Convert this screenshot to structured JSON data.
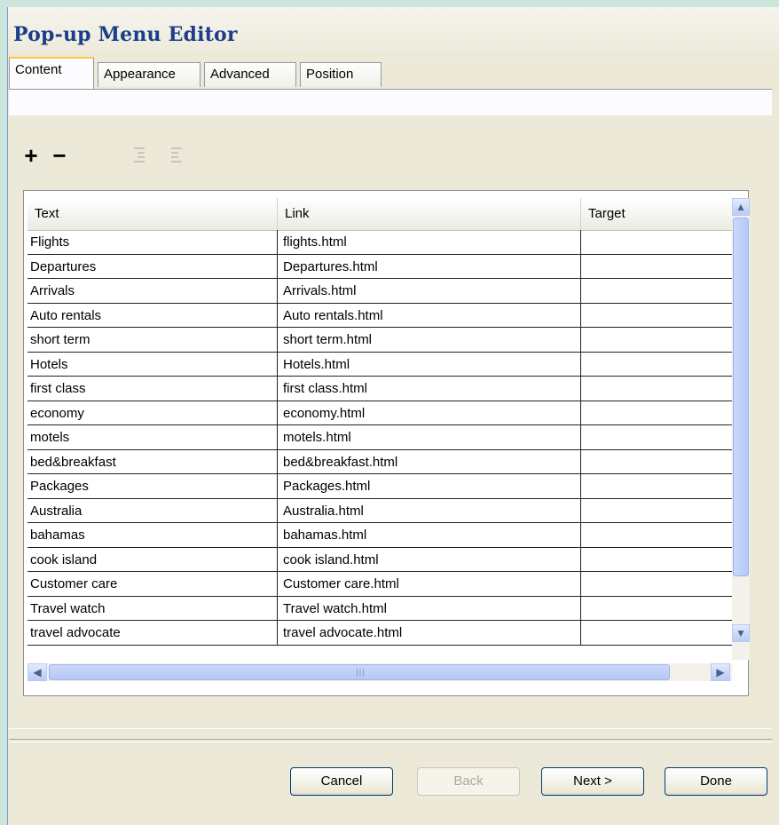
{
  "window": {
    "title": "Pop-up Menu Editor"
  },
  "tabs": [
    {
      "label": "Content",
      "active": true
    },
    {
      "label": "Appearance",
      "active": false
    },
    {
      "label": "Advanced",
      "active": false
    },
    {
      "label": "Position",
      "active": false
    }
  ],
  "toolbar": {
    "add_label": "+",
    "remove_label": "−",
    "add_icon": "plus-icon",
    "remove_icon": "minus-icon",
    "indent_icon": "indent-icon",
    "outdent_icon": "outdent-icon"
  },
  "grid": {
    "columns": [
      "Text",
      "Link",
      "Target"
    ],
    "rows": [
      {
        "text": "Flights",
        "link": "flights.html",
        "target": ""
      },
      {
        "text": "Departures",
        "link": "Departures.html",
        "target": ""
      },
      {
        "text": "Arrivals",
        "link": "Arrivals.html",
        "target": ""
      },
      {
        "text": "Auto rentals",
        "link": "Auto rentals.html",
        "target": ""
      },
      {
        "text": "short term",
        "link": "short term.html",
        "target": ""
      },
      {
        "text": "Hotels",
        "link": "Hotels.html",
        "target": ""
      },
      {
        "text": "first class",
        "link": "first class.html",
        "target": ""
      },
      {
        "text": "economy",
        "link": "economy.html",
        "target": ""
      },
      {
        "text": "motels",
        "link": "motels.html",
        "target": ""
      },
      {
        "text": "bed&breakfast",
        "link": "bed&breakfast.html",
        "target": ""
      },
      {
        "text": "Packages",
        "link": "Packages.html",
        "target": ""
      },
      {
        "text": "Australia",
        "link": "Australia.html",
        "target": ""
      },
      {
        "text": "bahamas",
        "link": "bahamas.html",
        "target": ""
      },
      {
        "text": "cook island",
        "link": "cook island.html",
        "target": ""
      },
      {
        "text": "Customer care",
        "link": "Customer care.html",
        "target": ""
      },
      {
        "text": "Travel watch",
        "link": "Travel watch.html",
        "target": ""
      },
      {
        "text": "travel advocate",
        "link": "travel advocate.html",
        "target": ""
      }
    ]
  },
  "buttons": {
    "cancel": "Cancel",
    "back": "Back",
    "next": "Next >",
    "done": "Done"
  },
  "colors": {
    "title": "#1c3e8a",
    "accent_tab": "#ffc83c",
    "scrollbar": "#b5c8f6"
  }
}
